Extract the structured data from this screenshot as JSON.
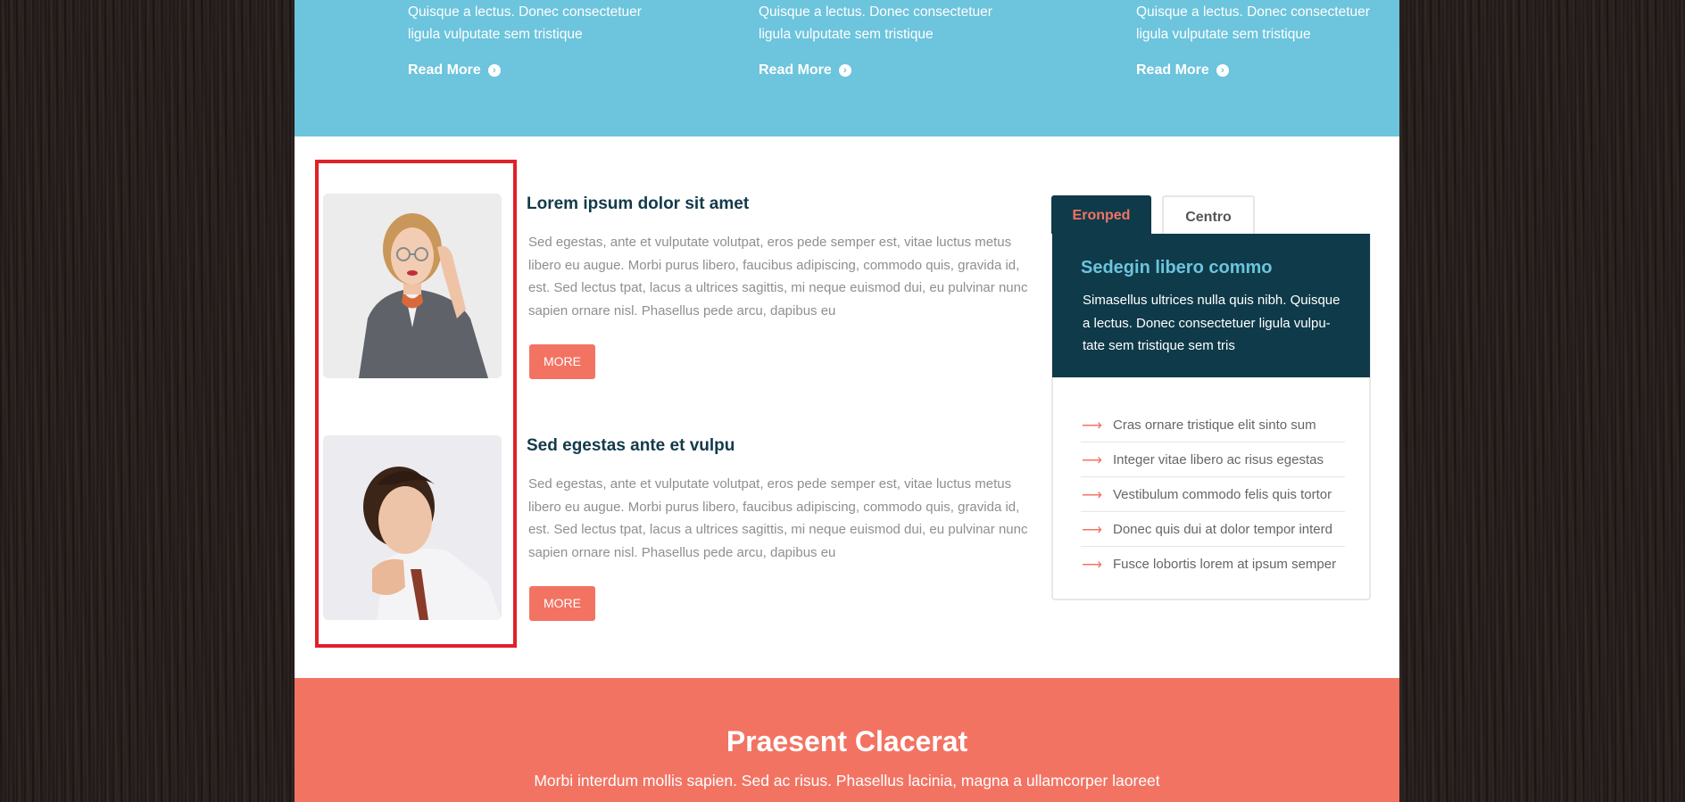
{
  "teasers": [
    {
      "text": "Quisque a lectus. Donec consectetuer ligula vulputate sem tristique",
      "link": "Read More"
    },
    {
      "text": "Quisque a lectus. Donec consectetuer ligula vulputate sem tristique",
      "link": "Read More"
    },
    {
      "text": "Quisque a lectus. Donec consectetuer ligula vulputate sem tristique",
      "link": "Read More"
    }
  ],
  "articles": [
    {
      "title": "Lorem ipsum dolor sit amet",
      "body": "Sed egestas, ante et vulputate volutpat, eros pede semper est, vitae luctus metus libero eu augue. Morbi purus libero, faucibus adipiscing, commodo quis, gravida id, est. Sed lectus tpat, lacus a ultrices sagittis, mi neque euismod dui, eu pulvinar nunc sapien ornare nisl. Phasellus pede arcu, dapibus eu",
      "button": "MORE"
    },
    {
      "title": "Sed egestas ante et vulpu",
      "body": "Sed egestas, ante et vulputate volutpat, eros pede semper est, vitae luctus metus libero eu augue. Morbi purus libero, faucibus adipiscing, commodo quis, gravida id, est. Sed lectus tpat, lacus a ultrices sagittis, mi neque euismod dui, eu pulvinar nunc sapien ornare nisl. Phasellus pede arcu, dapibus eu",
      "button": "MORE"
    }
  ],
  "tabs": {
    "items": [
      "Eronped",
      "Centro"
    ],
    "panel": {
      "title": "Sedegin libero commo",
      "text": "Simasellus ultrices nulla quis nibh. Quisque a lectus. Donec consectetuer ligula vulpu-tate sem tristique sem tris",
      "list": [
        "Cras ornare tristique elit  sinto sum",
        "Integer vitae libero ac risus egestas",
        "Vestibulum commodo felis quis tortor",
        "Donec quis dui at dolor tempor interd",
        "Fusce lobortis lorem at ipsum semper"
      ]
    }
  },
  "banner": {
    "title": "Praesent Clacerat",
    "subtitle": "Morbi interdum mollis sapien. Sed ac risus. Phasellus lacinia, magna a ullamcorper laoreet"
  },
  "icons": {
    "read_more": "arrow-circle-right-icon",
    "list_bullet": "long-arrow-right-icon"
  },
  "colors": {
    "blue": "#6cc4dd",
    "navy": "#0f3a49",
    "coral": "#f37363",
    "highlight": "#e0202a"
  }
}
